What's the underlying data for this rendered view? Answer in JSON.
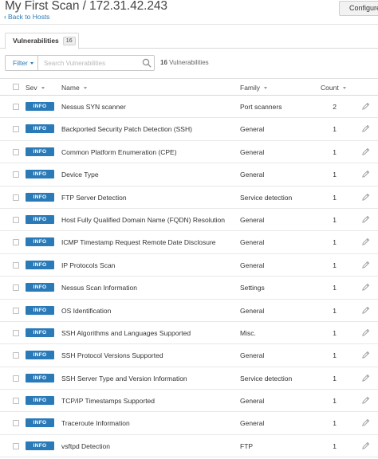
{
  "header": {
    "title": "My First Scan / 172.31.42.243",
    "back_label": "Back to Hosts",
    "configure_label": "Configure"
  },
  "tabs": [
    {
      "label": "Vulnerabilities",
      "count": "16"
    }
  ],
  "filter": {
    "label": "Filter",
    "search_placeholder": "Search Vulnerabilities",
    "search_value": "",
    "result_count": "16",
    "result_label": "Vulnerabilities"
  },
  "table": {
    "columns": {
      "sev": "Sev",
      "name": "Name",
      "family": "Family",
      "count": "Count"
    },
    "rows": [
      {
        "sev": "INFO",
        "name": "Nessus SYN scanner",
        "family": "Port scanners",
        "count": "2"
      },
      {
        "sev": "INFO",
        "name": "Backported Security Patch Detection (SSH)",
        "family": "General",
        "count": "1"
      },
      {
        "sev": "INFO",
        "name": "Common Platform Enumeration (CPE)",
        "family": "General",
        "count": "1"
      },
      {
        "sev": "INFO",
        "name": "Device Type",
        "family": "General",
        "count": "1"
      },
      {
        "sev": "INFO",
        "name": "FTP Server Detection",
        "family": "Service detection",
        "count": "1"
      },
      {
        "sev": "INFO",
        "name": "Host Fully Qualified Domain Name (FQDN) Resolution",
        "family": "General",
        "count": "1"
      },
      {
        "sev": "INFO",
        "name": "ICMP Timestamp Request Remote Date Disclosure",
        "family": "General",
        "count": "1"
      },
      {
        "sev": "INFO",
        "name": "IP Protocols Scan",
        "family": "General",
        "count": "1"
      },
      {
        "sev": "INFO",
        "name": "Nessus Scan Information",
        "family": "Settings",
        "count": "1"
      },
      {
        "sev": "INFO",
        "name": "OS Identification",
        "family": "General",
        "count": "1"
      },
      {
        "sev": "INFO",
        "name": "SSH Algorithms and Languages Supported",
        "family": "Misc.",
        "count": "1"
      },
      {
        "sev": "INFO",
        "name": "SSH Protocol Versions Supported",
        "family": "General",
        "count": "1"
      },
      {
        "sev": "INFO",
        "name": "SSH Server Type and Version Information",
        "family": "Service detection",
        "count": "1"
      },
      {
        "sev": "INFO",
        "name": "TCP/IP Timestamps Supported",
        "family": "General",
        "count": "1"
      },
      {
        "sev": "INFO",
        "name": "Traceroute Information",
        "family": "General",
        "count": "1"
      },
      {
        "sev": "INFO",
        "name": "vsftpd Detection",
        "family": "FTP",
        "count": "1"
      }
    ]
  },
  "colors": {
    "accent": "#2a7ab8",
    "info_badge": "#2a7ab8"
  },
  "icons": {
    "back": "chevron-left-icon",
    "search": "search-icon",
    "edit": "pencil-icon"
  }
}
